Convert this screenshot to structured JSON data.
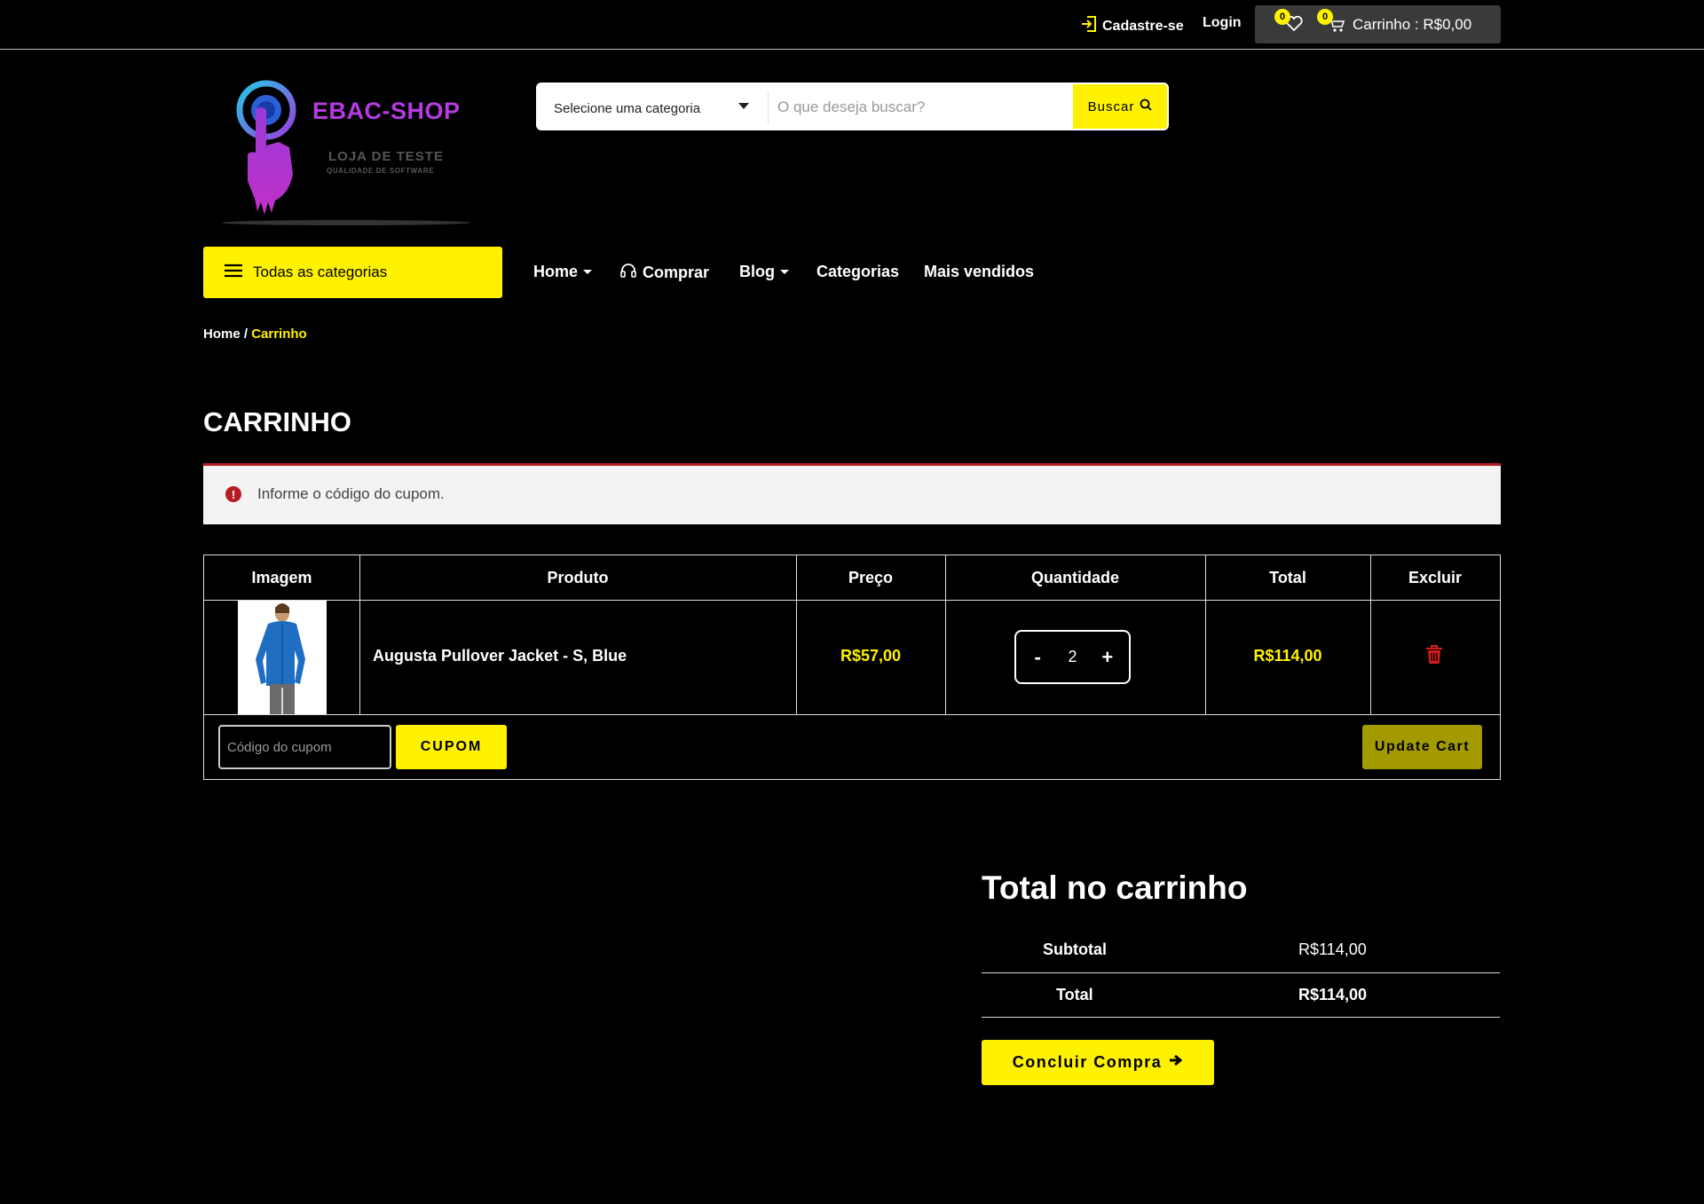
{
  "topbar": {
    "signup_label": "Cadastre-se",
    "login_label": "Login",
    "wishlist_count": "0",
    "cart_count": "0",
    "cart_label": "Carrinho : R$0,00"
  },
  "logo": {
    "name": "EBAC-SHOP",
    "tagline": "LOJA DE TESTE",
    "subtagline": "QUALIDADE DE SOFTWARE"
  },
  "search": {
    "category_selected": "Selecione uma categoria",
    "placeholder": "O que deseja buscar?",
    "button_label": "Buscar"
  },
  "nav": {
    "all_categories": "Todas as categorias",
    "items": [
      "Home",
      "Comprar",
      "Blog",
      "Categorias",
      "Mais vendidos"
    ]
  },
  "breadcrumb": {
    "home": "Home",
    "separator": " / ",
    "current": "Carrinho"
  },
  "page_title": "CARRINHO",
  "notice": {
    "text": "Informe o código do cupom."
  },
  "cart_table": {
    "headers": [
      "Imagem",
      "Produto",
      "Preço",
      "Quantidade",
      "Total",
      "Excluir"
    ],
    "rows": [
      {
        "product": "Augusta Pullover Jacket - S, Blue",
        "price": "R$57,00",
        "quantity": "2",
        "total": "R$114,00"
      }
    ],
    "qty_minus": "-",
    "qty_plus": "+",
    "coupon_placeholder": "Código do cupom",
    "coupon_button": "CUPOM",
    "update_button": "Update Cart"
  },
  "totals": {
    "title": "Total no carrinho",
    "subtotal_label": "Subtotal",
    "subtotal_value": "R$114,00",
    "total_label": "Total",
    "total_value": "R$114,00",
    "checkout_label": "Concluir Compra"
  },
  "colors": {
    "accent": "#fff200",
    "error": "#b81c23",
    "brand": "#b43be0"
  }
}
